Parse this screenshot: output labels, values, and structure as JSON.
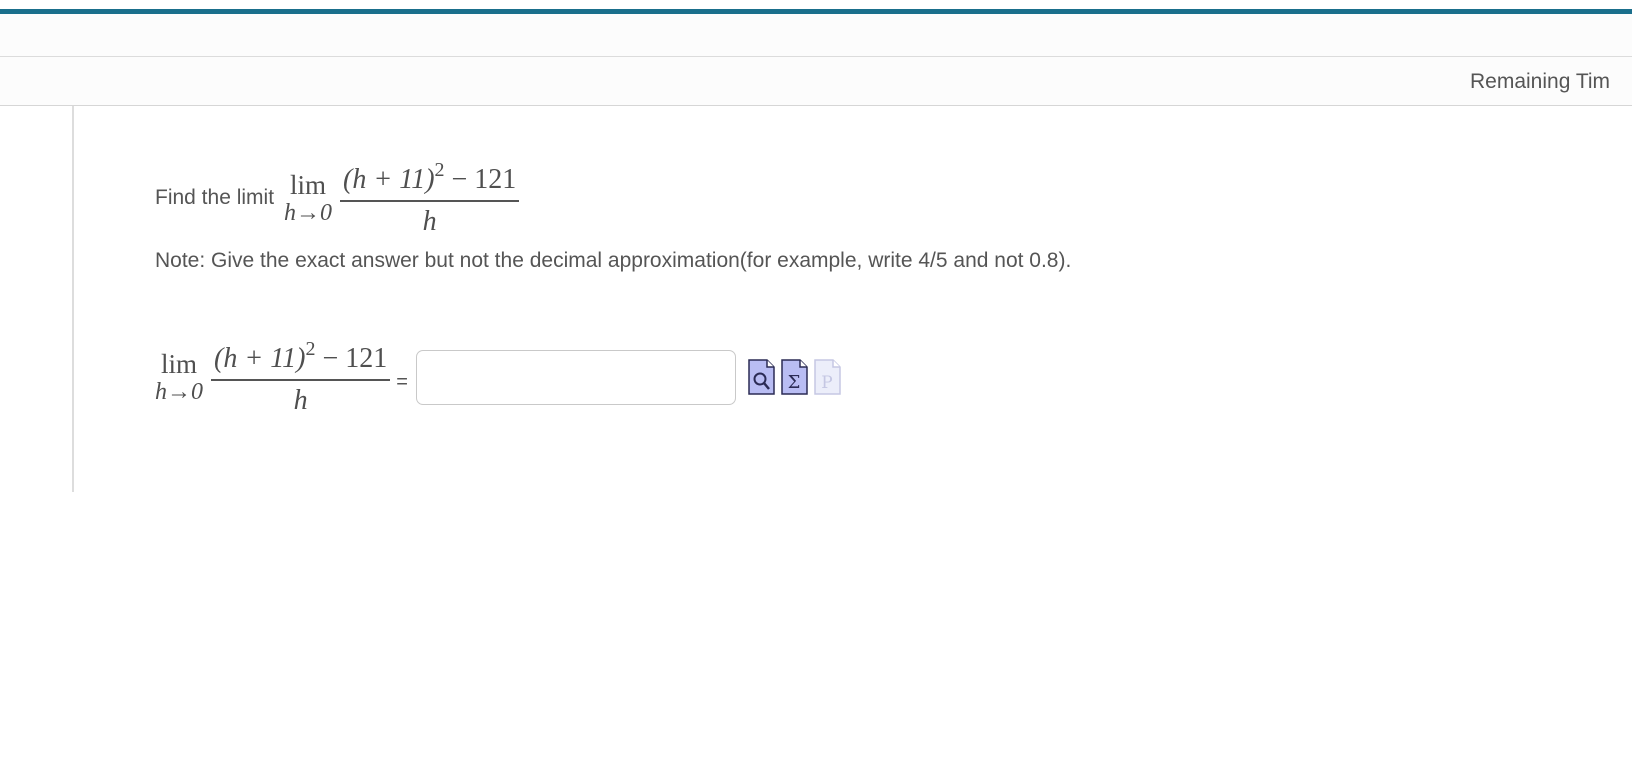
{
  "header": {
    "timer_label": "Remaining Tim"
  },
  "question": {
    "prompt": "Find the limit",
    "limit_word": "lim",
    "limit_sub": "h→0",
    "numerator_left": "(h + 11)",
    "numerator_exp": "2",
    "numerator_right": " − 121",
    "denominator": "h",
    "note": "Note: Give the exact answer but not the decimal approximation(for example, write 4/5 and not 0.8)."
  },
  "answer": {
    "limit_word": "lim",
    "limit_sub": "h→0",
    "numerator_left": "(h + 11)",
    "numerator_exp": "2",
    "numerator_right": " − 121",
    "denominator": "h",
    "equals": "=",
    "value": "",
    "placeholder": ""
  },
  "tools": [
    {
      "name": "preview-icon",
      "glyph": "magnifier",
      "enabled": true
    },
    {
      "name": "equation-editor-icon",
      "glyph": "Σ",
      "enabled": true
    },
    {
      "name": "formula-p-icon",
      "glyph": "P",
      "enabled": false
    }
  ],
  "colors": {
    "accent": "#1a6f8c",
    "tool_fill": "#b9bdf3",
    "tool_disabled": "#e6e7f7",
    "text": "#555555"
  }
}
